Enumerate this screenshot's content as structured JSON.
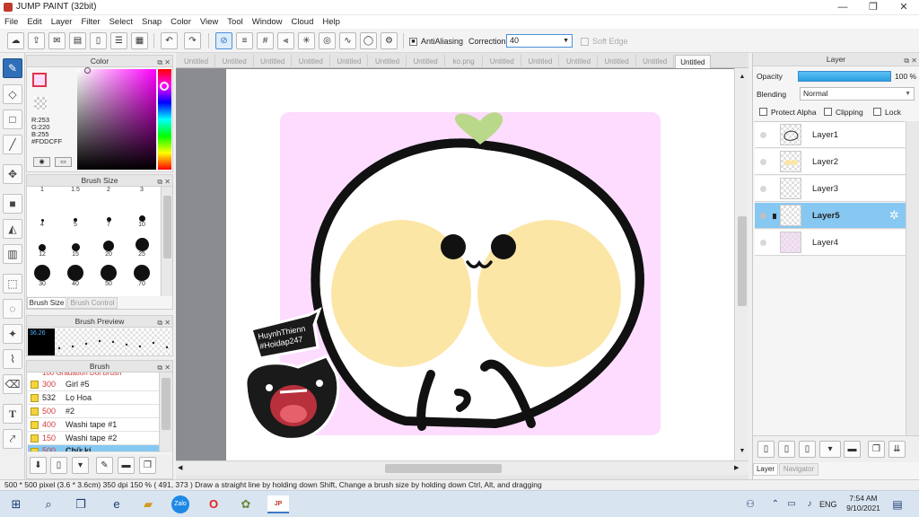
{
  "app": {
    "title": "JUMP PAINT (32bit)"
  },
  "window_controls": {
    "minimize": "—",
    "maximize": "❐",
    "close": "✕"
  },
  "menu": [
    "File",
    "Edit",
    "Layer",
    "Filter",
    "Select",
    "Snap",
    "Color",
    "View",
    "Tool",
    "Window",
    "Cloud",
    "Help"
  ],
  "toolbar": {
    "antialiasing_label": "AntiAliasing",
    "correction_label": "Correction",
    "correction_value": "40",
    "soft_edge_label": "Soft Edge"
  },
  "tabs": [
    "Untitled",
    "Untitled",
    "Untitled",
    "Untitled",
    "Untitled",
    "Untitled",
    "Untitled",
    "ko.png",
    "Untitled",
    "Untitled",
    "Untitled",
    "Untitled",
    "Untitled",
    "Untitled"
  ],
  "active_tab_index": 13,
  "color_panel": {
    "title": "Color",
    "r": "R:253",
    "g": "G:220",
    "b": "B:255",
    "hex": "#FDDCFF",
    "primary_color": "#FDDCFF",
    "accent_color": "#e0334b"
  },
  "brush_size_panel": {
    "title": "Brush Size",
    "sizes": [
      "1",
      "1.5",
      "2",
      "3",
      "4",
      "5",
      "7",
      "10",
      "12",
      "15",
      "20",
      "25",
      "30",
      "40",
      "50",
      "70"
    ],
    "tab_active": "Brush Size",
    "tab_inactive": "Brush Control"
  },
  "brush_preview_panel": {
    "title": "Brush Preview",
    "value": "36.26"
  },
  "brush_panel": {
    "title": "Brush",
    "partial_top": "100  Gradation Dot Brush",
    "items": [
      {
        "size": "300",
        "name": "Girl #5"
      },
      {
        "size": "532",
        "name": "Lọ Hoa"
      },
      {
        "size": "500",
        "name": "#2"
      },
      {
        "size": "400",
        "name": "Washi tape #1"
      },
      {
        "size": "150",
        "name": "Washi tape #2"
      },
      {
        "size": "500",
        "name": "Chữ kí"
      }
    ]
  },
  "layer_panel": {
    "title": "Layer",
    "opacity_label": "Opacity",
    "opacity_value": "100 %",
    "blending_label": "Blending",
    "blending_value": "Normal",
    "protect_alpha": "Protect Alpha",
    "clipping": "Clipping",
    "lock": "Lock",
    "layers": [
      {
        "name": "Layer1",
        "selected": false
      },
      {
        "name": "Layer2",
        "selected": false
      },
      {
        "name": "Layer3",
        "selected": false
      },
      {
        "name": "Layer5",
        "selected": true
      },
      {
        "name": "Layer4",
        "selected": false
      }
    ],
    "tab_layer": "Layer",
    "tab_navigator": "Navigator"
  },
  "canvas": {
    "sticker_text_line1": "HuynhThienn",
    "sticker_text_line2": "#Hoidap247"
  },
  "status": {
    "text": "500 * 500 pixel   (3.6 * 3.6cm)   350 dpi   150 %   ( 491, 373 )   Draw a straight line by holding down Shift, Change a brush size by holding down Ctrl, Alt, and dragging"
  },
  "taskbar": {
    "lang": "ENG",
    "time": "7:54 AM",
    "date": "9/10/2021"
  }
}
